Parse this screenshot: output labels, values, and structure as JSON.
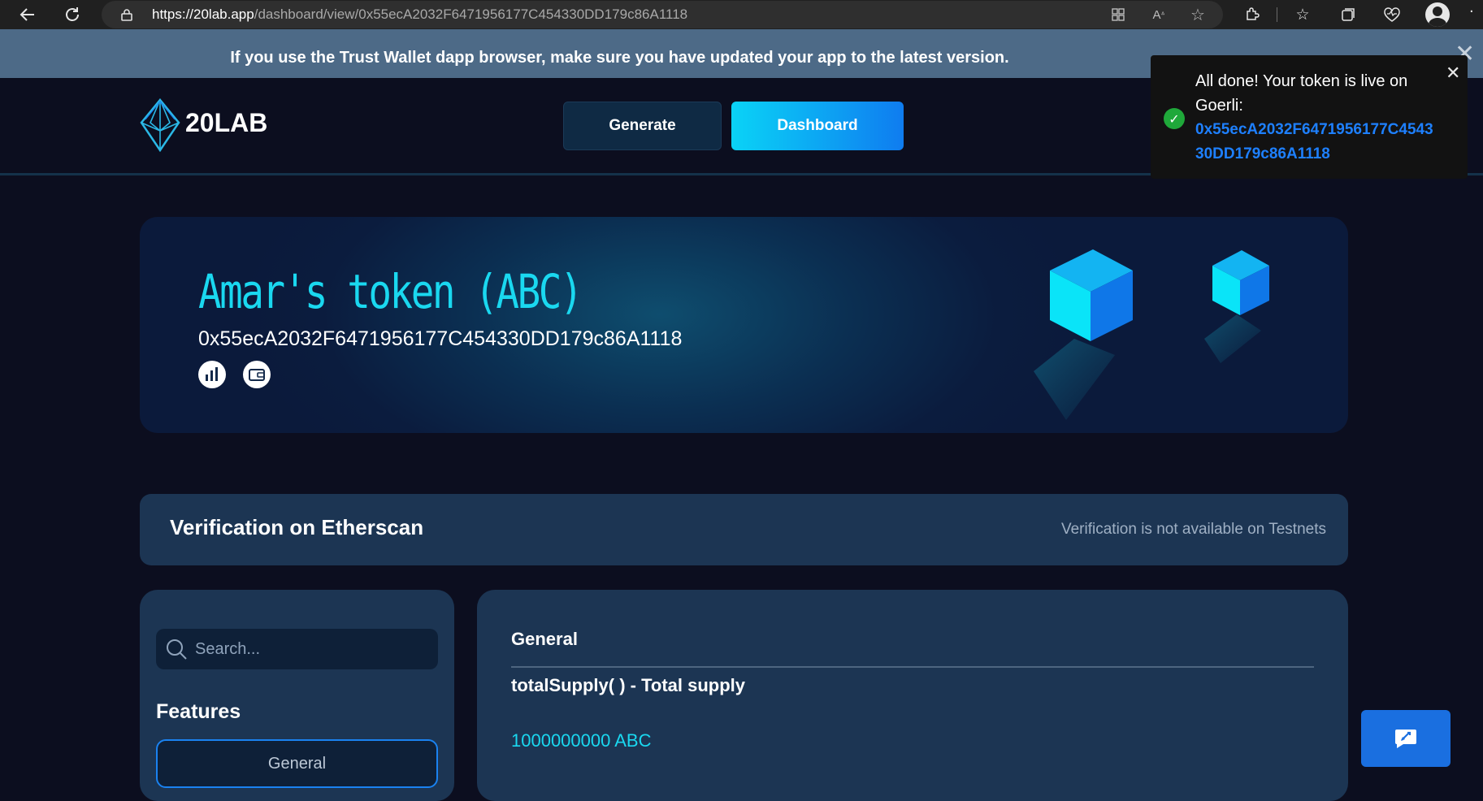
{
  "browser": {
    "url_host": "https://20lab.app",
    "url_path": "/dashboard/view/0x55ecA2032F6471956177C454330DD179c86A1118",
    "back_icon": "arrow-left-icon",
    "refresh_icon": "refresh-icon",
    "lock_icon": "lock-icon"
  },
  "notice": {
    "text": "If you use the Trust Wallet dapp browser, make sure you have updated your app to the latest version.",
    "close": "✕"
  },
  "header": {
    "logo_text": "20LAB",
    "nav": {
      "generate": "Generate",
      "dashboard": "Dashboard"
    }
  },
  "toast": {
    "message": "All done! Your token is live on Goerli:",
    "link": "0x55ecA2032F6471956177C454330DD179c86A1118",
    "close": "✕",
    "status_color": "#1fa83a"
  },
  "token": {
    "title": "Amar's token (ABC)",
    "address": "0x55ecA2032F6471956177C454330DD179c86A1118",
    "icons": [
      "chart-icon",
      "wallet-icon"
    ]
  },
  "verification": {
    "title": "Verification on Etherscan",
    "note": "Verification is not available on Testnets"
  },
  "sidebar": {
    "search_placeholder": "Search...",
    "features_heading": "Features",
    "items": [
      {
        "label": "General",
        "active": true
      }
    ]
  },
  "main": {
    "section": "General",
    "function_label": "totalSupply( ) - Total supply",
    "value": "1000000000 ABC"
  },
  "colors": {
    "accent": "#1ad8f0",
    "brand_blue": "#0f7cf0",
    "background": "#0c0e1f",
    "card": "#1c3553"
  }
}
